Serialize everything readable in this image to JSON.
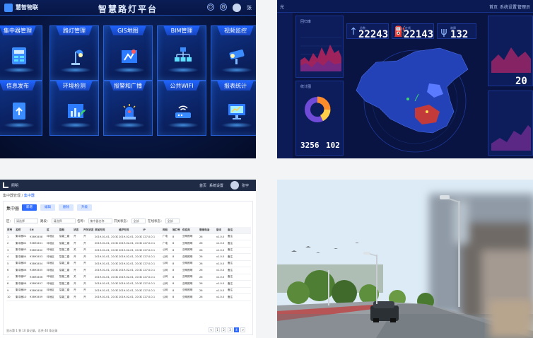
{
  "dashboard": {
    "brand": "慧智物联",
    "title": "智慧路灯平台",
    "user": "张",
    "tiles": [
      {
        "label": "集中器管理",
        "icon": "concentrator-icon"
      },
      {
        "label": "路灯管理",
        "icon": "street-lamp-icon"
      },
      {
        "label": "GIS地图",
        "icon": "gis-map-icon"
      },
      {
        "label": "BIM管理",
        "icon": "bim-tree-icon"
      },
      {
        "label": "视频监控",
        "icon": "camera-icon"
      },
      {
        "label": "信息发布",
        "icon": "document-publish-icon"
      },
      {
        "label": "环境检测",
        "icon": "environment-chart-icon"
      },
      {
        "label": "报警和广播",
        "icon": "alarm-siren-icon"
      },
      {
        "label": "公共WIFI",
        "icon": "wifi-router-icon"
      },
      {
        "label": "报表统计",
        "icon": "monitor-report-icon"
      }
    ],
    "accent": "#1f64ff"
  },
  "map_dashboard": {
    "top_title": "光",
    "top_right": [
      "首页",
      "系统设置",
      "管理员"
    ],
    "cards": {
      "left_top_title": "回归率",
      "left_mid_title": "统计图",
      "stats": [
        {
          "value": "22243",
          "label": "总数"
        },
        {
          "value": "22143",
          "label": "在线"
        },
        {
          "value": "132",
          "label": "故障"
        }
      ],
      "bottom_nums": [
        "3256",
        "102"
      ],
      "right_num": "20"
    },
    "colors": {
      "area": "#b8245c",
      "map": "#2b4fd6",
      "highlight": "#e03a3a"
    }
  },
  "table_page": {
    "top_title": "照明",
    "top_right": [
      "首页",
      "系统设置",
      "张宇"
    ],
    "breadcrumb": [
      "集中器管理",
      "集中器"
    ],
    "section_title": "集中器",
    "buttons": [
      "新增",
      "编辑",
      "删除",
      "升级"
    ],
    "filters": [
      {
        "label": "区：",
        "value": "请选择"
      },
      {
        "label": "路段：",
        "value": "请选择"
      },
      {
        "label": "名称：",
        "value": "集中器名称"
      },
      {
        "label": "开关状态：",
        "value": "全部"
      },
      {
        "label": "在线状态：",
        "value": "全部"
      }
    ],
    "columns": [
      "序号",
      "名称",
      "SN",
      "区",
      "路段",
      "状态",
      "开关状态",
      "添加时间",
      "维护时间",
      "IP",
      "网段",
      "端口号",
      "供应商",
      "营维电话",
      "版本",
      "备注"
    ],
    "rows": [
      [
        "1",
        "集中器01",
        "93893458",
        "坪地区",
        "智能二路",
        "开",
        "开",
        "2019-01-01, 20:30",
        "2019-02-01, 20:30",
        "127.0.0.1",
        "广电",
        "8",
        "亚明照明",
        "26",
        "v1.0.0",
        "备注"
      ],
      [
        "2",
        "集中器02",
        "93893451",
        "坪地区",
        "智能二路",
        "开",
        "开",
        "2019-01-01, 20:30",
        "2019-02-01, 20:30",
        "127.0.0.1",
        "广电",
        "8",
        "亚明照明",
        "26",
        "v1.0.0",
        "备注"
      ],
      [
        "3",
        "集中器03",
        "93893452",
        "坪地区",
        "智能二路",
        "关",
        "开",
        "2019-01-01, 20:30",
        "2019-02-01, 20:30",
        "127.0.0.1",
        "公网",
        "8",
        "亚明照明",
        "26",
        "v1.0.0",
        "备注"
      ],
      [
        "4",
        "集中器04",
        "93893453",
        "坪地区",
        "智能二路",
        "开",
        "开",
        "2019-01-01, 20:30",
        "2019-02-01, 20:30",
        "127.0.0.1",
        "公网",
        "8",
        "亚明照明",
        "26",
        "v1.0.0",
        "备注"
      ],
      [
        "5",
        "集中器05",
        "93893454",
        "坪地区",
        "智能二路",
        "开",
        "开",
        "2019-01-01, 20:30",
        "2019-02-01, 20:30",
        "127.0.0.1",
        "公网",
        "8",
        "亚明照明",
        "26",
        "v1.0.0",
        "备注"
      ],
      [
        "6",
        "集中器06",
        "93893455",
        "坪地区",
        "智能二路",
        "开",
        "开",
        "2019-01-01, 20:30",
        "2019-02-01, 20:30",
        "127.0.0.1",
        "公网",
        "8",
        "亚明照明",
        "26",
        "v1.0.0",
        "备注"
      ],
      [
        "7",
        "集中器07",
        "93893456",
        "坪地区",
        "智能二路",
        "关",
        "开",
        "2019-01-01, 20:30",
        "2019-02-01, 20:30",
        "127.0.0.1",
        "公网",
        "8",
        "亚明照明",
        "26",
        "v1.0.0",
        "备注"
      ],
      [
        "8",
        "集中器08",
        "93893457",
        "坪地区",
        "智能二路",
        "开",
        "开",
        "2019-01-01, 20:30",
        "2019-02-01, 20:30",
        "127.0.0.1",
        "公网",
        "8",
        "亚明照明",
        "26",
        "v1.0.0",
        "备注"
      ],
      [
        "9",
        "集中器09",
        "93893458",
        "坪地区",
        "智能二路",
        "开",
        "开",
        "2019-01-01, 20:30",
        "2019-02-01, 20:30",
        "127.0.0.1",
        "公网",
        "8",
        "亚明照明",
        "26",
        "v1.0.0",
        "备注"
      ],
      [
        "10",
        "集中器10",
        "93893459",
        "坪地区",
        "智能二路",
        "开",
        "开",
        "2019-01-01, 20:30",
        "2019-02-01, 20:30",
        "127.0.0.1",
        "公网",
        "8",
        "亚明照明",
        "26",
        "v1.0.0",
        "备注"
      ]
    ],
    "footer": "显示第 1 到 10 条记录，总共 40 条记录",
    "pages": [
      "<",
      "1",
      "2",
      "3",
      "4",
      ">"
    ],
    "current_page": "4"
  },
  "photo": {
    "subject": "street-light-road-photo"
  }
}
